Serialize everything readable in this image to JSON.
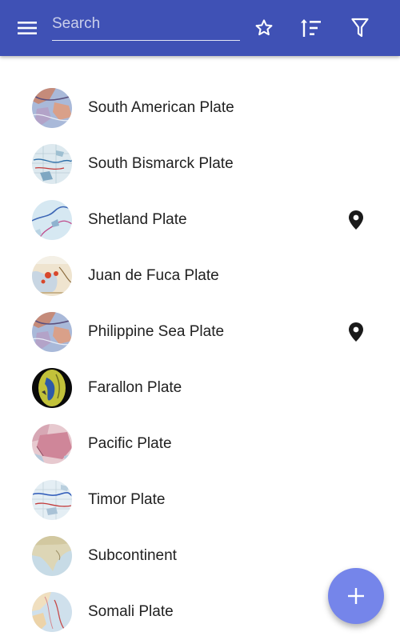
{
  "appbar": {
    "color": "#3f51b5",
    "menu_icon": "menu-icon",
    "search": {
      "placeholder": "Search",
      "value": ""
    },
    "actions": [
      {
        "icon": "star-outline-icon"
      },
      {
        "icon": "sort-icon"
      },
      {
        "icon": "filter-icon"
      }
    ]
  },
  "plates": [
    {
      "label": "South American Plate",
      "pinned": false
    },
    {
      "label": "South Bismarck Plate",
      "pinned": false
    },
    {
      "label": "Shetland Plate",
      "pinned": true
    },
    {
      "label": "Juan de Fuca Plate",
      "pinned": false
    },
    {
      "label": "Philippine Sea Plate",
      "pinned": true
    },
    {
      "label": "Farallon Plate",
      "pinned": false
    },
    {
      "label": "Pacific Plate",
      "pinned": false
    },
    {
      "label": "Timor Plate",
      "pinned": false
    },
    {
      "label": "Subcontinent",
      "pinned": false
    },
    {
      "label": "Somali Plate",
      "pinned": false
    }
  ],
  "pin_icon": "map-marker-icon",
  "fab": {
    "icon": "plus-icon",
    "color": "#7585ea"
  }
}
